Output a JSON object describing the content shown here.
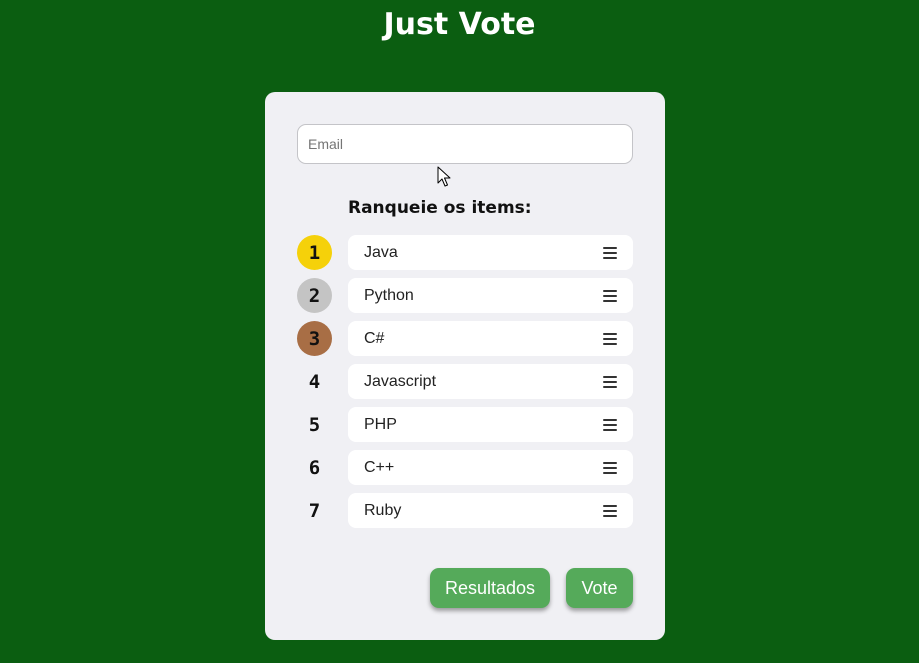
{
  "app": {
    "title": "Just Vote",
    "background_color": "#0b5e11"
  },
  "form": {
    "email_placeholder": "Email",
    "email_value": "",
    "rank_heading": "Ranqueie os items:"
  },
  "ranking": {
    "items": [
      {
        "rank": "1",
        "label": "Java",
        "badge_color": "#f5d10a",
        "handle_icon": "drag-handle-icon"
      },
      {
        "rank": "2",
        "label": "Python",
        "badge_color": "#c4c4c4",
        "handle_icon": "drag-handle-icon"
      },
      {
        "rank": "3",
        "label": "C#",
        "badge_color": "#a86e45",
        "handle_icon": "drag-handle-icon"
      },
      {
        "rank": "4",
        "label": "Javascript",
        "badge_color": "",
        "handle_icon": "drag-handle-icon"
      },
      {
        "rank": "5",
        "label": "PHP",
        "badge_color": "",
        "handle_icon": "drag-handle-icon"
      },
      {
        "rank": "6",
        "label": "C++",
        "badge_color": "",
        "handle_icon": "drag-handle-icon"
      },
      {
        "rank": "7",
        "label": "Ruby",
        "badge_color": "",
        "handle_icon": "drag-handle-icon"
      }
    ]
  },
  "actions": {
    "results_label": "Resultados",
    "vote_label": "Vote",
    "button_color": "#55aa5a"
  }
}
